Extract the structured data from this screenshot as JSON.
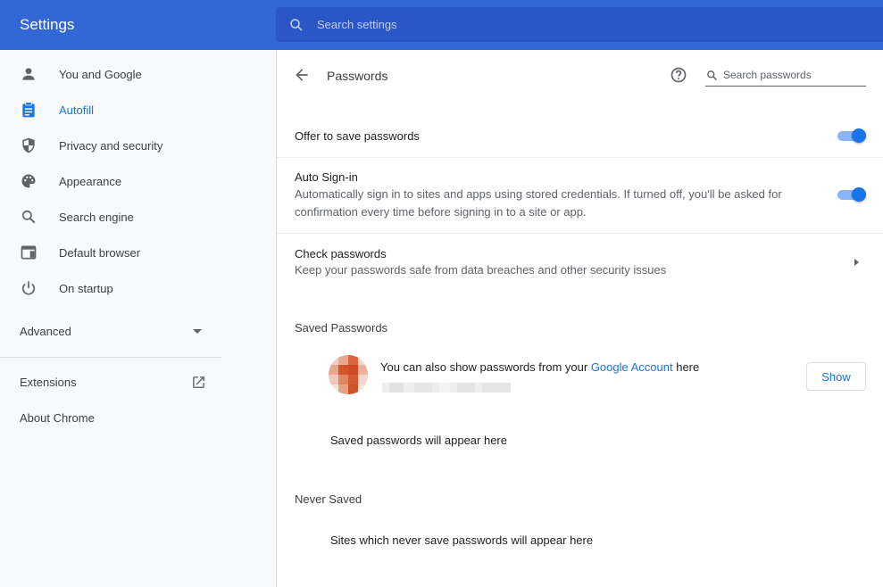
{
  "header": {
    "title": "Settings",
    "search_placeholder": "Search settings"
  },
  "sidebar": {
    "items": [
      {
        "label": "You and Google",
        "icon": "person-icon"
      },
      {
        "label": "Autofill",
        "icon": "clipboard-icon"
      },
      {
        "label": "Privacy and security",
        "icon": "shield-icon"
      },
      {
        "label": "Appearance",
        "icon": "palette-icon"
      },
      {
        "label": "Search engine",
        "icon": "search-icon"
      },
      {
        "label": "Default browser",
        "icon": "browser-window-icon"
      },
      {
        "label": "On startup",
        "icon": "power-icon"
      }
    ],
    "active_item": "Autofill",
    "advanced_label": "Advanced",
    "extensions_label": "Extensions",
    "about_label": "About Chrome"
  },
  "main": {
    "page_title": "Passwords",
    "search_placeholder": "Search passwords",
    "offer_to_save": {
      "label": "Offer to save passwords",
      "enabled": true
    },
    "auto_signin": {
      "label": "Auto Sign-in",
      "description": "Automatically sign in to sites and apps using stored credentials. If turned off, you'll be asked for confirmation every time before signing in to a site or app.",
      "enabled": true
    },
    "check_passwords": {
      "label": "Check passwords",
      "description": "Keep your passwords safe from data breaches and other security issues"
    },
    "saved_passwords": {
      "heading": "Saved Passwords",
      "account_text_before": "You can also show passwords from your ",
      "account_link": "Google Account",
      "account_text_after": " here",
      "show_button": "Show",
      "empty_message": "Saved passwords will appear here"
    },
    "never_saved": {
      "heading": "Never Saved",
      "empty_message": "Sites which never save passwords will appear here"
    }
  },
  "colors": {
    "header_bg": "#3367d6",
    "accent": "#1a73e8",
    "toggle_track": "#8ab4f8"
  }
}
